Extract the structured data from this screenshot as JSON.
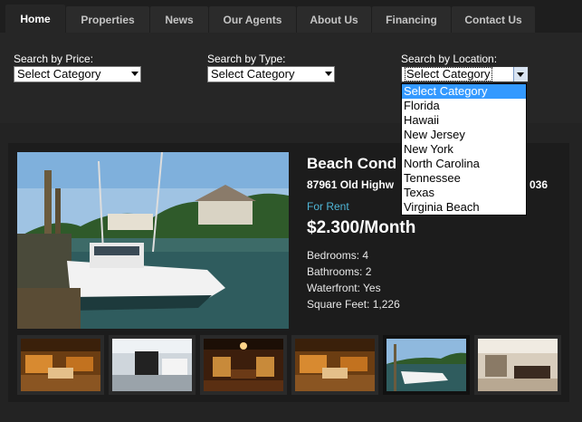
{
  "nav": {
    "tabs": [
      {
        "label": "Home",
        "active": true
      },
      {
        "label": "Properties",
        "active": false
      },
      {
        "label": "News",
        "active": false
      },
      {
        "label": "Our Agents",
        "active": false
      },
      {
        "label": "About Us",
        "active": false
      },
      {
        "label": "Financing",
        "active": false
      },
      {
        "label": "Contact Us",
        "active": false
      }
    ]
  },
  "search": {
    "price_label": "Search by Price:",
    "price_value": "Select Category",
    "type_label": "Search by Type:",
    "type_value": "Select Category",
    "location_label": "Search by Location:",
    "location_value": "Select Category",
    "location_options": [
      "Select Category",
      "Florida",
      "Hawaii",
      "New Jersey",
      "New York",
      "North Carolina",
      "Tennessee",
      "Texas",
      "Virginia Beach"
    ]
  },
  "listing": {
    "title": "Beach Cond",
    "address_start": "87961 Old Highw",
    "address_end": "036",
    "status": "For Rent",
    "price": "$2.300/Month",
    "details": [
      "Bedrooms: 4",
      "Bathrooms: 2",
      "Waterfront: Yes",
      "Square Feet: 1,226"
    ]
  },
  "colors": {
    "accent": "#4fb6d8",
    "selection": "#3399ff",
    "background": "#232323"
  }
}
